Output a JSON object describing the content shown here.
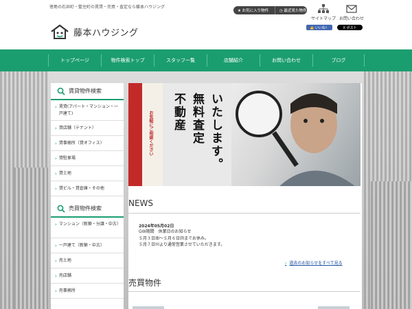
{
  "header": {
    "tagline": "徳島の石井町・藍住町の賃貸・売買・査定なら藤本ハウジング",
    "logo_text": "藤本ハウジング",
    "favorites_label": "★ お気に入り物件",
    "recent_label": "◷ 最近見た物件",
    "sitemap_label": "サイトマップ",
    "contact_label": "お問い合わせ",
    "like_label": "👍 いいね！",
    "post_label": "X ポスト"
  },
  "nav": {
    "items": [
      "トップページ",
      "物件検索トップ",
      "スタッフ一覧",
      "店舗紹介",
      "お問い合わせ",
      "ブログ"
    ]
  },
  "sidebar": {
    "rent_heading": "賃貸物件検索",
    "rent_items": [
      "賃貸(アパート・マンション・一戸建て)",
      "貸店舗（テナント）",
      "貸事務所（貸オフィス）",
      "貸駐車場",
      "貸土地",
      "貸ビル・貸倉庫・その他"
    ],
    "sale_heading": "売買物件検索",
    "sale_items": [
      "マンション（新築・分譲・中古）",
      "一戸建て（新築・中古）",
      "売土地",
      "売店舗",
      "売事務所"
    ]
  },
  "hero": {
    "banner_line1": "いたします。",
    "banner_line2": "無料査定",
    "banner_line3": "不動産",
    "side_tag": "お気軽にご相談ください"
  },
  "news": {
    "title": "NEWS",
    "date": "2024年05月02日",
    "lines": [
      "GW期間　休業日のお知らせ",
      "５月３日㈮～５月６日㈪までお休み。",
      "５月７日㈫より通常営業させていただきます。"
    ],
    "more_label": "過去のお知らせをすべて見る"
  },
  "sale": {
    "title": "売買物件"
  },
  "colors": {
    "accent": "#1b9e6f",
    "banner_red": "#c22a2a",
    "link": "#1a4fa0"
  },
  "icons": [
    "house-logo-icon",
    "search-icon",
    "sitemap-icon",
    "mail-icon",
    "star-icon",
    "clock-icon",
    "chevron-right-icon"
  ]
}
